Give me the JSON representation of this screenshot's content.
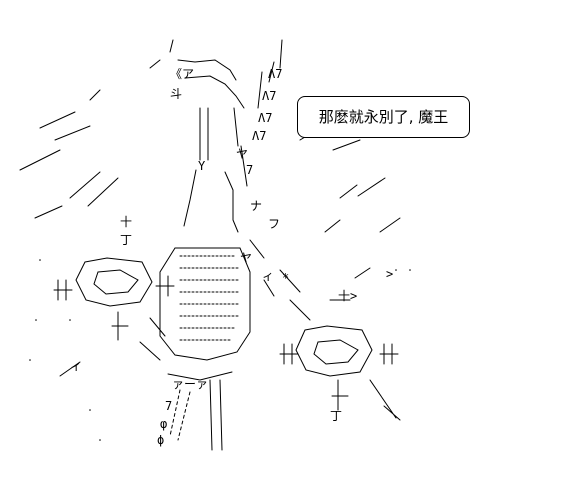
{
  "speech": {
    "text": "那麽就永別了, 魔王"
  },
  "colors": {
    "background": "#ffffff",
    "ink": "#000000"
  }
}
